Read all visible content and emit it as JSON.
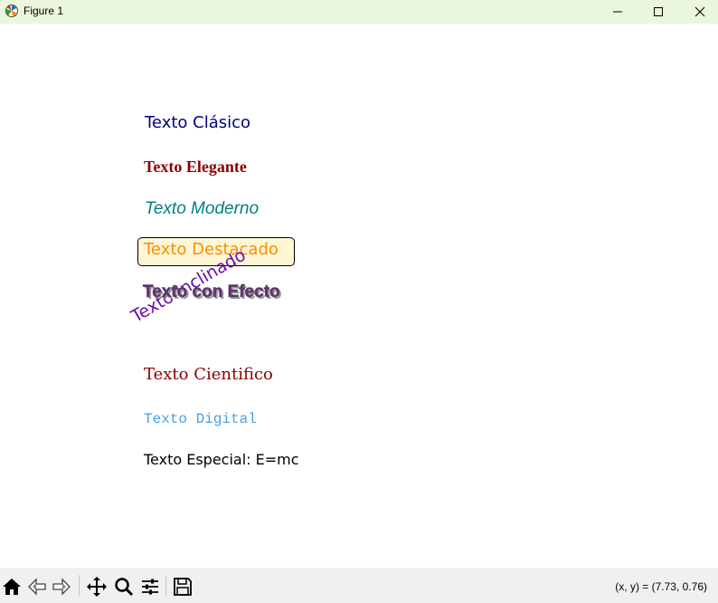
{
  "window": {
    "title": "Figure 1",
    "controls": {
      "minimize_icon": "minimize-icon",
      "maximize_icon": "maximize-icon",
      "close_icon": "close-icon"
    }
  },
  "figure": {
    "texts": [
      {
        "key": "clasico",
        "text": "Texto Clásico",
        "color": "#000080"
      },
      {
        "key": "elegante",
        "text": "Texto Elegante",
        "color": "#8b0000"
      },
      {
        "key": "moderno",
        "text": "Texto Moderno",
        "color": "#008080"
      },
      {
        "key": "destacado",
        "text": "Texto Destacado",
        "color": "#ff8c00",
        "box_color": "#fff6d5"
      },
      {
        "key": "efecto",
        "text": "Texto con Efecto",
        "color": "#6a2a7a"
      },
      {
        "key": "inclinado",
        "text": "Texto Inclinado",
        "color": "#6a0dad",
        "rotation_deg": 30
      },
      {
        "key": "cientifico",
        "text": "Texto Cientifico",
        "color": "#8b0000"
      },
      {
        "key": "digital",
        "text": "Texto Digital",
        "color": "#4a9fe0"
      },
      {
        "key": "especial",
        "text": "Texto Especial: E=mc",
        "color": "#000000"
      }
    ]
  },
  "toolbar": {
    "buttons": [
      {
        "name": "home-icon"
      },
      {
        "name": "back-icon"
      },
      {
        "name": "forward-icon"
      },
      {
        "name": "pan-icon"
      },
      {
        "name": "zoom-icon"
      },
      {
        "name": "configure-subplots-icon"
      },
      {
        "name": "save-icon"
      }
    ],
    "coordinates": "(x, y) = (7.73, 0.76)"
  }
}
